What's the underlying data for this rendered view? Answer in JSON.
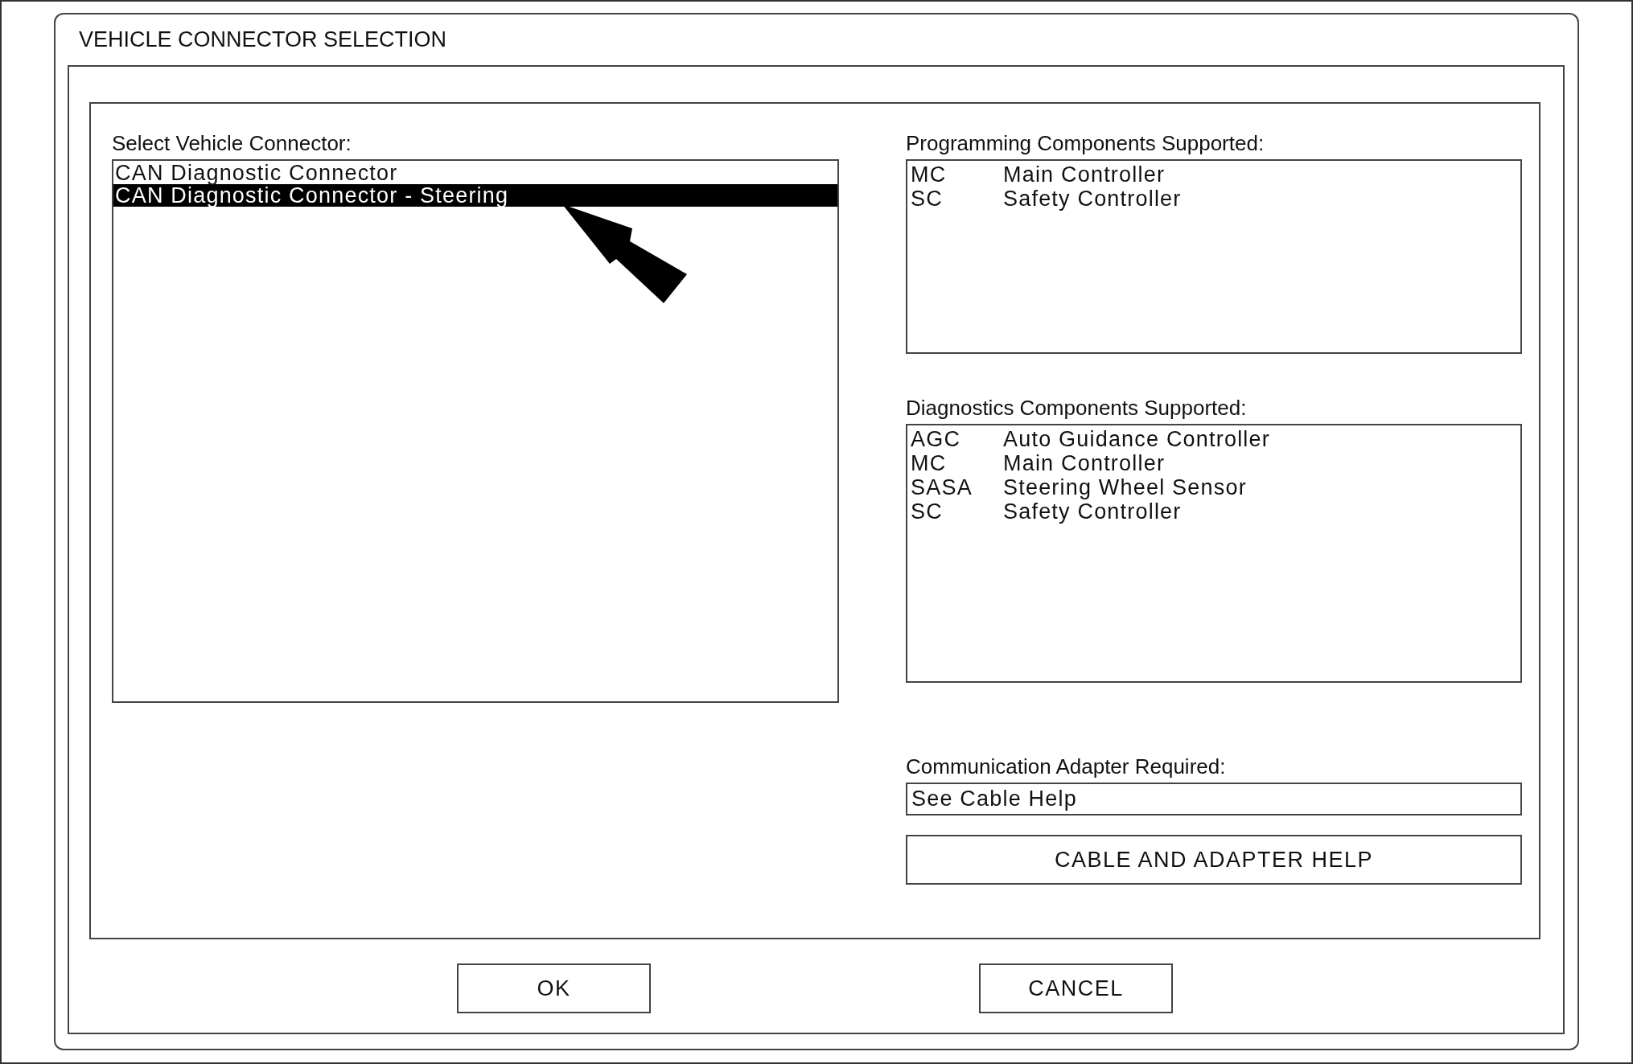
{
  "dialog": {
    "title": "VEHICLE CONNECTOR SELECTION",
    "connector_list": {
      "label": "Select Vehicle Connector:",
      "items": [
        {
          "label": "CAN Diagnostic Connector",
          "selected": false
        },
        {
          "label": "CAN Diagnostic Connector - Steering",
          "selected": true
        }
      ]
    },
    "programming": {
      "label": "Programming Components Supported:",
      "rows": [
        {
          "code": "MC",
          "name": "Main Controller"
        },
        {
          "code": "SC",
          "name": "Safety Controller"
        }
      ]
    },
    "diagnostics": {
      "label": "Diagnostics Components Supported:",
      "rows": [
        {
          "code": "AGC",
          "name": "Auto Guidance Controller"
        },
        {
          "code": "MC",
          "name": "Main Controller"
        },
        {
          "code": "SASA",
          "name": "Steering Wheel Sensor"
        },
        {
          "code": "SC",
          "name": "Safety Controller"
        }
      ]
    },
    "adapter": {
      "label": "Communication Adapter Required:",
      "value": "See Cable Help"
    },
    "help_button": "CABLE AND ADAPTER HELP",
    "buttons": [
      "OK",
      "CANCEL"
    ]
  }
}
